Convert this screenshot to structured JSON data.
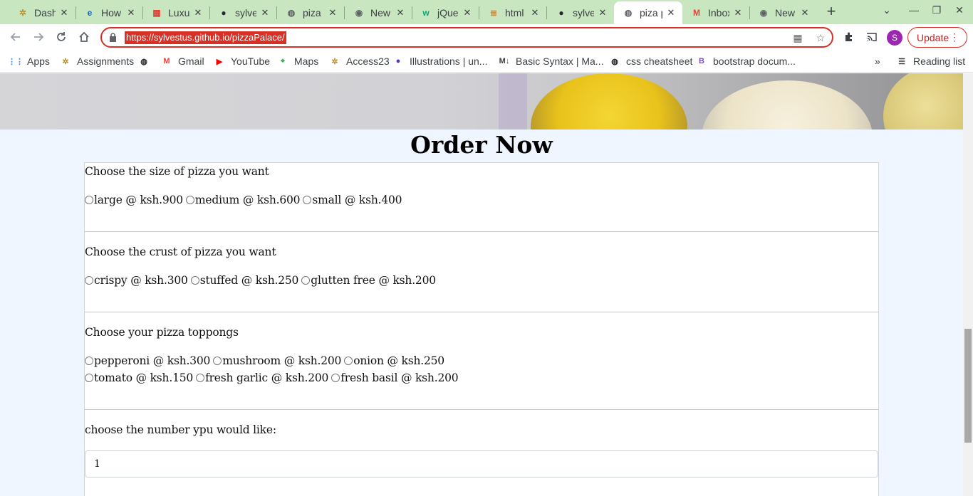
{
  "browser": {
    "tabs": [
      {
        "title": "Dashl",
        "icon": "tree-icon",
        "color": "#b5912f"
      },
      {
        "title": "How t",
        "icon": "e-icon",
        "color": "#1565c0"
      },
      {
        "title": "Luxu",
        "icon": "grid-icon",
        "color": "#db4437"
      },
      {
        "title": "sylve",
        "icon": "github-icon",
        "color": "#24292e"
      },
      {
        "title": "piza p",
        "icon": "globe-icon",
        "color": "#5f6368"
      },
      {
        "title": "New T",
        "icon": "chrome-icon",
        "color": "#5f6368"
      },
      {
        "title": "jQue",
        "icon": "w-icon",
        "color": "#04aa6d"
      },
      {
        "title": "html",
        "icon": "stack-icon",
        "color": "#f48024"
      },
      {
        "title": "sylve",
        "icon": "github-icon",
        "color": "#24292e"
      },
      {
        "title": "piza p",
        "icon": "globe-icon",
        "color": "#5f6368",
        "active": true
      },
      {
        "title": "Inbox",
        "icon": "gmail-icon",
        "color": "#ea4335"
      },
      {
        "title": "New T",
        "icon": "chrome-icon",
        "color": "#5f6368"
      }
    ],
    "new_tab_label": "+",
    "url": "https://sylvestus.github.io/pizzaPalace/",
    "profile_initial": "S",
    "update_label": "Update",
    "bookmarks": [
      {
        "label": "Apps",
        "icon": "apps-icon"
      },
      {
        "label": "Assignments",
        "icon": "tree-icon"
      },
      {
        "label": "",
        "icon": "globe-icon"
      },
      {
        "label": "Gmail",
        "icon": "gmail-icon"
      },
      {
        "label": "YouTube",
        "icon": "youtube-icon"
      },
      {
        "label": "Maps",
        "icon": "maps-icon"
      },
      {
        "label": "Access23",
        "icon": "tree-icon"
      },
      {
        "label": "Illustrations | un...",
        "icon": "illustration-icon"
      },
      {
        "label": "Basic Syntax | Ma...",
        "icon": "markdown-icon"
      },
      {
        "label": "css cheatsheet",
        "icon": "globe-icon"
      },
      {
        "label": "bootstrap docum...",
        "icon": "bootstrap-icon"
      }
    ],
    "more_bookmarks": "»",
    "reading_list": "Reading list"
  },
  "page": {
    "heading": "Order Now",
    "size": {
      "question": "Choose the size of pizza you want",
      "options": [
        "large @ ksh.900",
        "medium @ ksh.600",
        "small @ ksh.400"
      ]
    },
    "crust": {
      "question": "Choose the crust of pizza you want",
      "options": [
        "crispy @ ksh.300",
        "stuffed @ ksh.250",
        "glutten free @ ksh.200"
      ]
    },
    "toppings": {
      "question": "Choose your pizza toppongs",
      "options_row1": [
        "pepperoni @ ksh.300",
        "mushroom @ ksh.200",
        "onion @ ksh.250"
      ],
      "options_row2": [
        "tomato @ ksh.150",
        "fresh garlic @ ksh.200",
        "fresh basil @ ksh.200"
      ]
    },
    "quantity": {
      "question": "choose the number ypu would like:",
      "value": "1"
    }
  }
}
